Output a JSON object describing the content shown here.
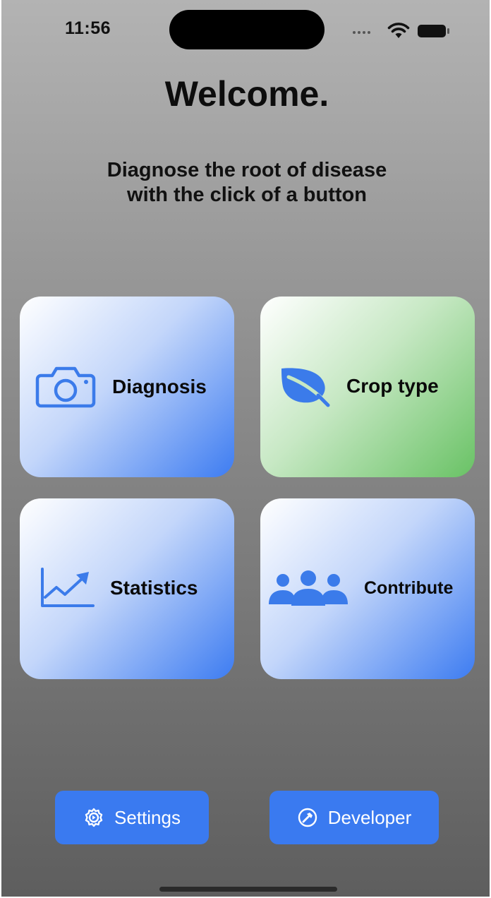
{
  "status_bar": {
    "time": "11:56",
    "icons": [
      "cellular-signal-icon",
      "wifi-icon",
      "battery-icon"
    ]
  },
  "header": {
    "title": "Welcome.",
    "subtitle_lines": [
      "Diagnose the root of disease",
      "with the click of a button"
    ]
  },
  "tiles": [
    {
      "label": "Diagnosis",
      "icon": "camera-icon",
      "color": "#3d7cf1"
    },
    {
      "label": "Crop type",
      "icon": "leaf-icon",
      "color": "#69c265"
    },
    {
      "label": "Statistics",
      "icon": "chart-line-uptrend-icon",
      "color": "#3d7cf1"
    },
    {
      "label": "Contribute",
      "icon": "people-group-icon",
      "color": "#3d7cf1"
    }
  ],
  "buttons": {
    "settings": {
      "label": "Settings",
      "icon": "gear-icon"
    },
    "developer": {
      "label": "Developer",
      "icon": "hammer-circle-icon"
    }
  },
  "colors": {
    "accent_blue": "#3a7af0",
    "icon_blue": "#3b7bea",
    "background_top": "#b3b3b3",
    "background_bottom": "#5e5e5e"
  }
}
